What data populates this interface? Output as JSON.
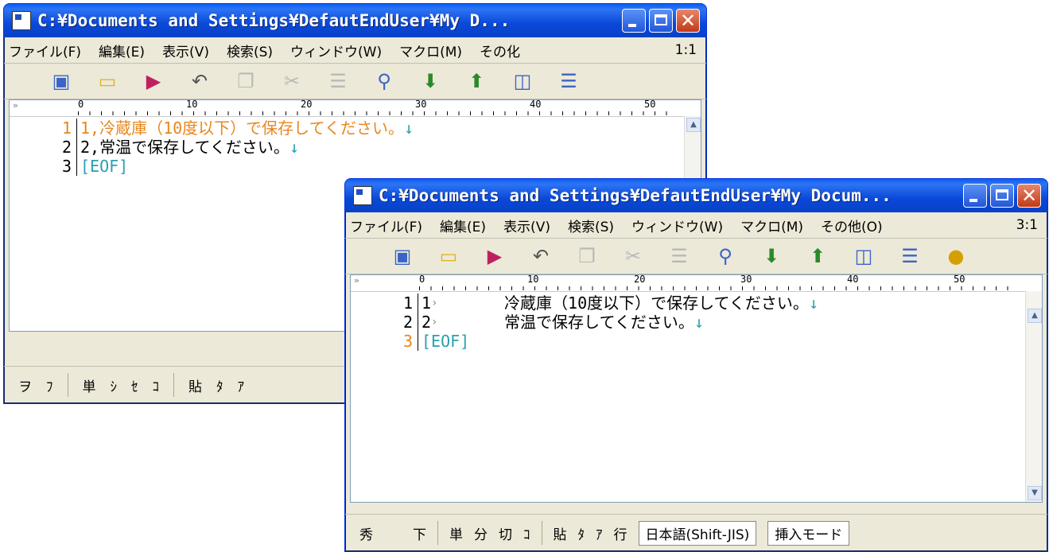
{
  "back_window": {
    "title": "C:¥Documents and Settings¥DefautEndUser¥My D...",
    "menu": [
      "ファイル(F)",
      "編集(E)",
      "表示(V)",
      "検索(S)",
      "ウィンドウ(W)",
      "マクロ(M)",
      "その化"
    ],
    "cursor_pos": "1:1",
    "ruler_labels": [
      "0",
      "10",
      "20",
      "30",
      "40",
      "50"
    ],
    "lines": [
      {
        "num": "1",
        "text": "1,冷蔵庫（10度以下）で保存してください。"
      },
      {
        "num": "2",
        "text": "2,常温で保存してください。"
      },
      {
        "num": "3",
        "text": "[EOF]"
      }
    ],
    "status": [
      "ヲ",
      "ﾌ",
      "単",
      "ｼ",
      "ｾ",
      "ｺ",
      "貼",
      "ﾀ",
      "ｱ"
    ]
  },
  "front_window": {
    "title": "C:¥Documents and Settings¥DefautEndUser¥My Docum...",
    "menu": [
      "ファイル(F)",
      "編集(E)",
      "表示(V)",
      "検索(S)",
      "ウィンドウ(W)",
      "マクロ(M)",
      "その他(O)"
    ],
    "cursor_pos": "3:1",
    "ruler_labels": [
      "0",
      "10",
      "20",
      "30",
      "40",
      "50"
    ],
    "lines": [
      {
        "num": "1",
        "prefix": "1",
        "text": "冷蔵庫（10度以下）で保存してください。"
      },
      {
        "num": "2",
        "prefix": "2",
        "text": "常温で保存してください。"
      },
      {
        "num": "3",
        "text": "[EOF]"
      }
    ],
    "status": [
      "秀",
      "下",
      "単",
      "分",
      "切",
      "ｺ",
      "貼",
      "ﾀ",
      "ｱ",
      "行"
    ],
    "encoding": "日本語(Shift-JIS)",
    "mode": "挿入モード"
  },
  "glyphs": {
    "newline": "↓",
    "tab": "›",
    "ruler_marker": "»",
    "close": "✕"
  },
  "colors": {
    "title_blue": "#0a48d8",
    "current_line": "#e8861c",
    "eof": "#2a9fb0"
  }
}
